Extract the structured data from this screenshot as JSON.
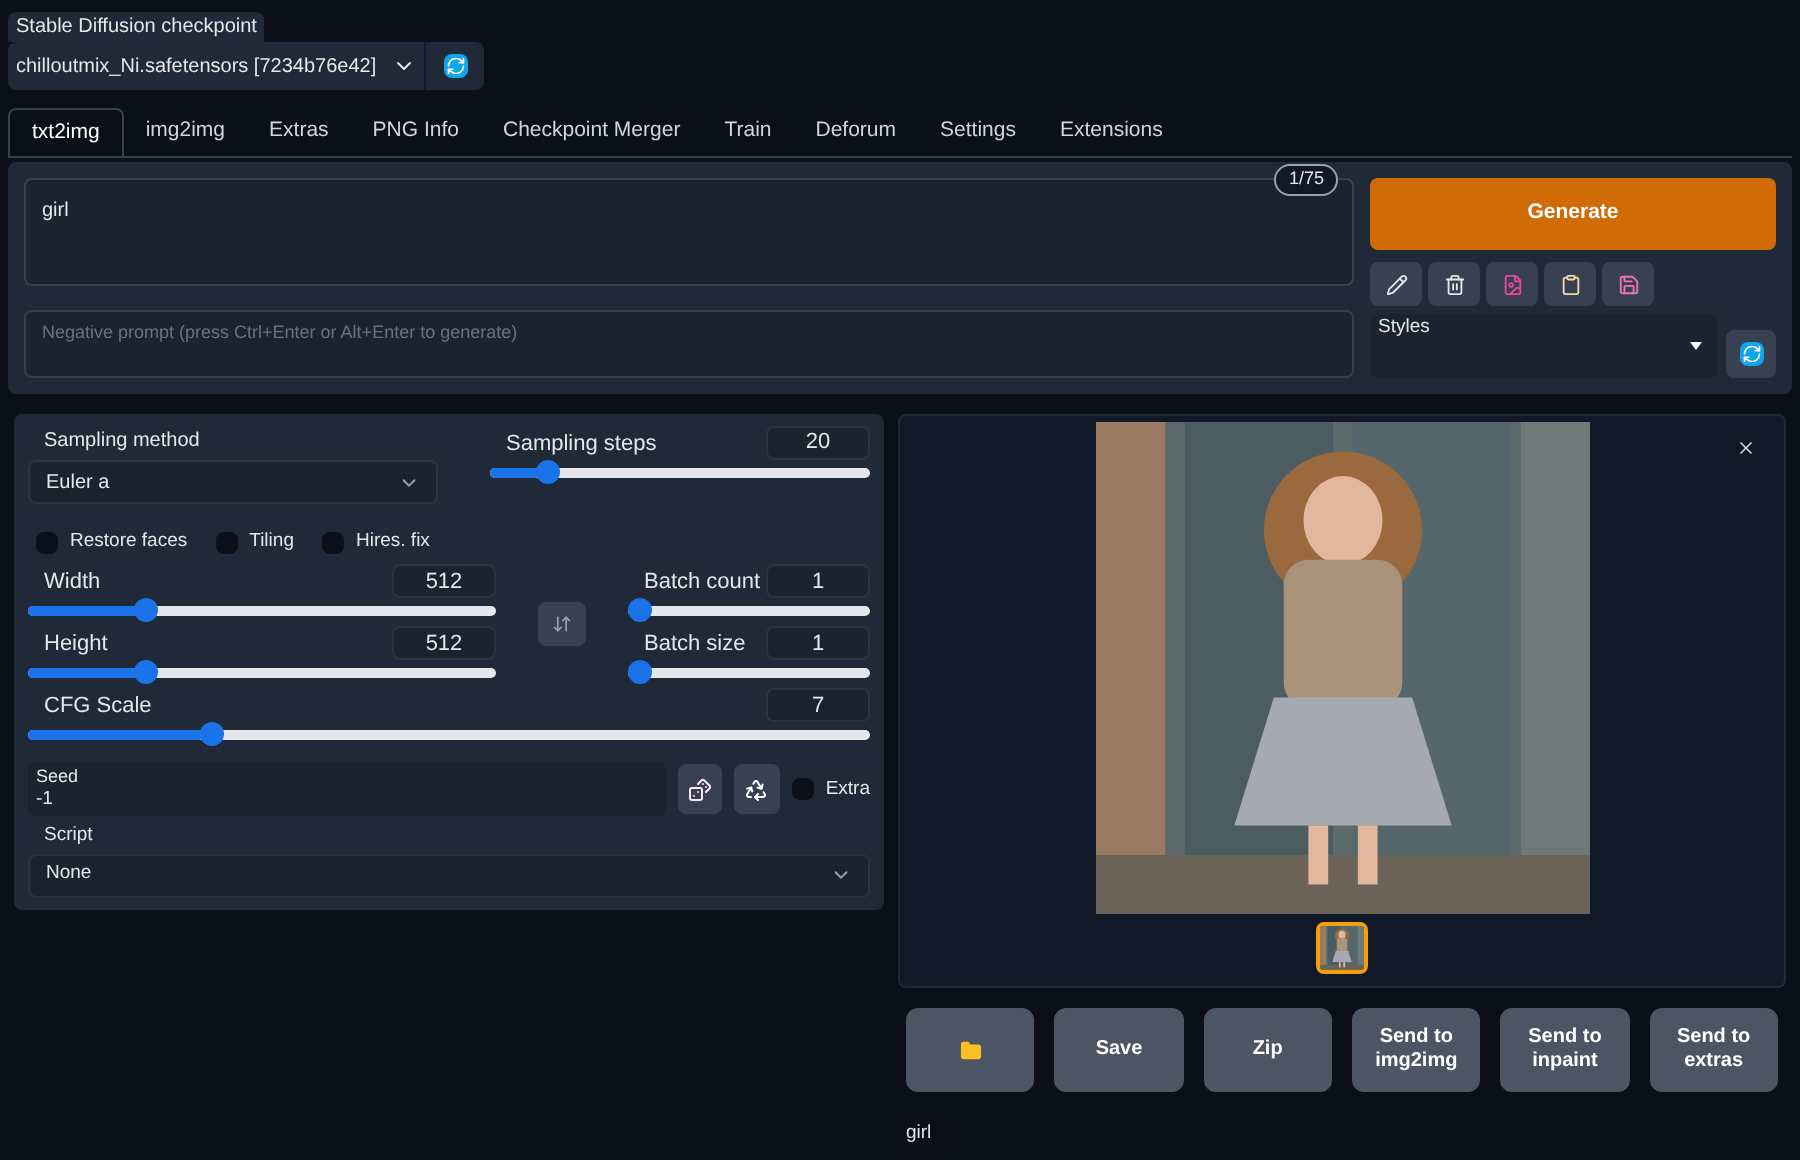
{
  "checkpoint": {
    "label": "Stable Diffusion checkpoint",
    "value": "chilloutmix_Ni.safetensors [7234b76e42]"
  },
  "tabs": [
    {
      "label": "txt2img",
      "selected": true
    },
    {
      "label": "img2img",
      "selected": false
    },
    {
      "label": "Extras",
      "selected": false
    },
    {
      "label": "PNG Info",
      "selected": false
    },
    {
      "label": "Checkpoint Merger",
      "selected": false
    },
    {
      "label": "Train",
      "selected": false
    },
    {
      "label": "Deforum",
      "selected": false
    },
    {
      "label": "Settings",
      "selected": false
    },
    {
      "label": "Extensions",
      "selected": false
    }
  ],
  "prompt": {
    "value": "girl",
    "token_count": "1/75"
  },
  "negative_prompt": {
    "placeholder": "Negative prompt (press Ctrl+Enter or Alt+Enter to generate)"
  },
  "generate_button": "Generate",
  "styles": {
    "label": "Styles"
  },
  "sampling_method": {
    "label": "Sampling method",
    "value": "Euler a"
  },
  "sampling_steps": {
    "label": "Sampling steps",
    "value": "20",
    "level": 0.13
  },
  "checkboxes": [
    {
      "label": "Restore faces",
      "checked": false
    },
    {
      "label": "Tiling",
      "checked": false
    },
    {
      "label": "Hires. fix",
      "checked": false
    }
  ],
  "width": {
    "label": "Width",
    "value": "512",
    "level": 0.24
  },
  "height": {
    "label": "Height",
    "value": "512",
    "level": 0.24
  },
  "batch_count": {
    "label": "Batch count",
    "value": "1",
    "level": 0
  },
  "batch_size": {
    "label": "Batch size",
    "value": "1",
    "level": 0
  },
  "cfg_scale": {
    "label": "CFG Scale",
    "value": "7",
    "level": 0.21
  },
  "seed": {
    "label": "Seed",
    "value": "-1"
  },
  "extra": {
    "label": "Extra",
    "checked": false
  },
  "script": {
    "label": "Script",
    "value": "None"
  },
  "gallery": {
    "thumbnails": [
      {
        "selected": true
      }
    ]
  },
  "actions": [
    {
      "kind": "folder"
    },
    {
      "kind": "text",
      "label": "Save"
    },
    {
      "kind": "text",
      "label": "Zip"
    },
    {
      "kind": "text",
      "label": "Send to img2img"
    },
    {
      "kind": "text",
      "label": "Send to inpaint"
    },
    {
      "kind": "text",
      "label": "Send to extras"
    }
  ],
  "caption": "girl"
}
